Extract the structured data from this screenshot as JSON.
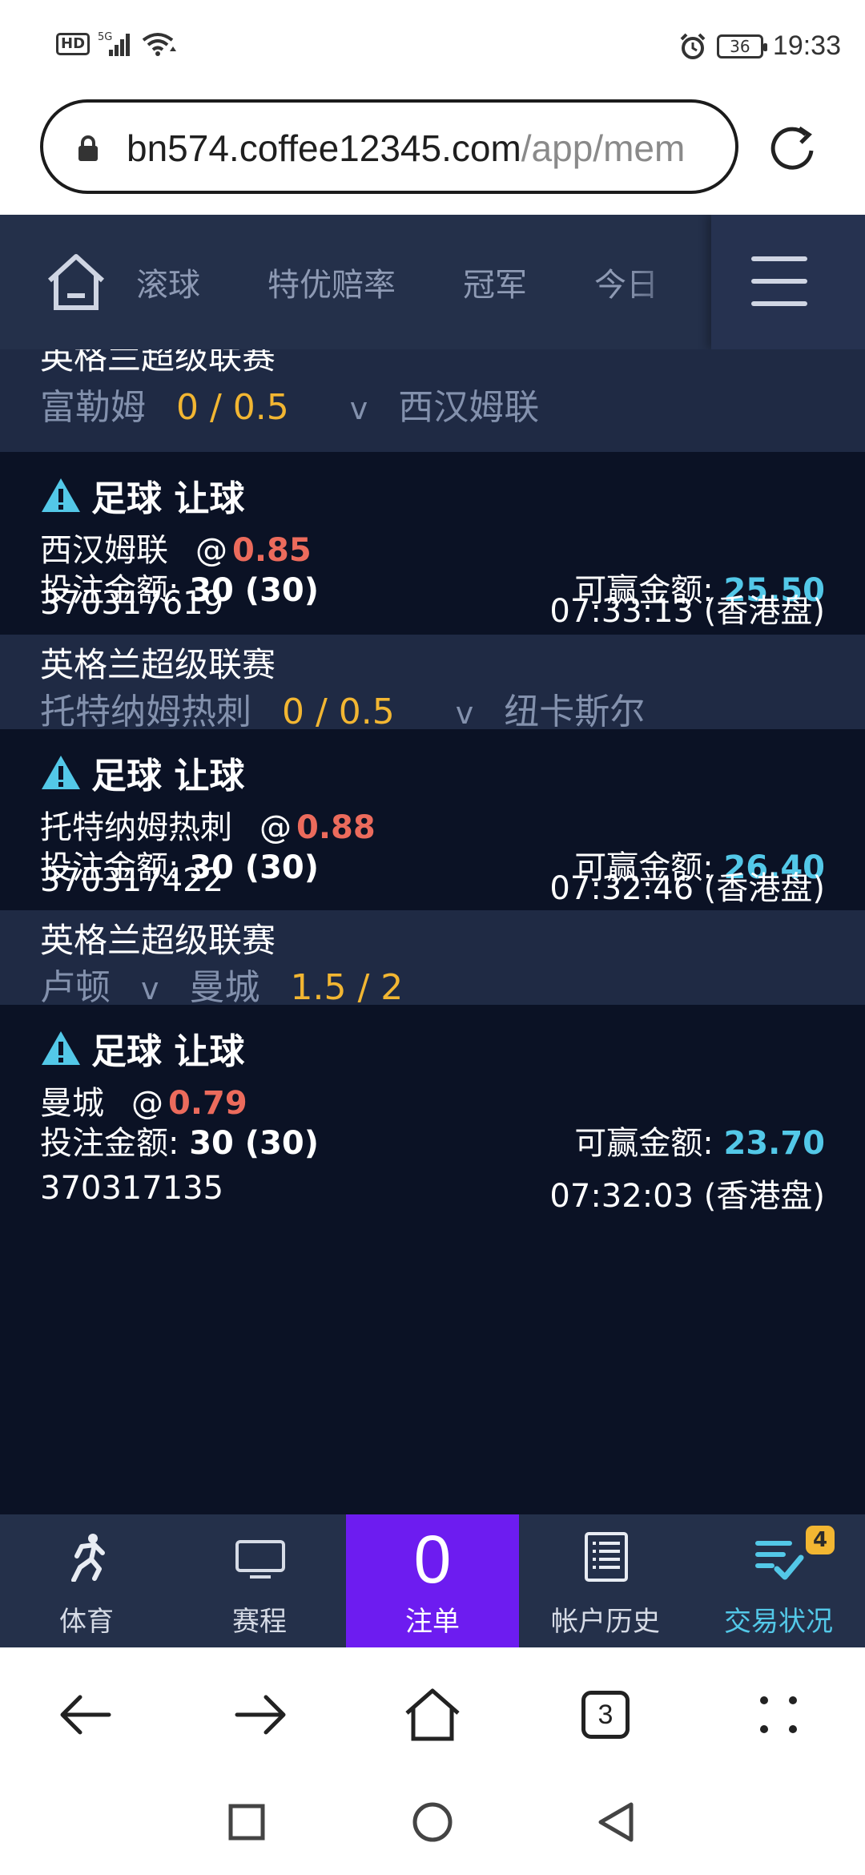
{
  "status_bar": {
    "network": "5G",
    "battery": "36",
    "time": "19:33",
    "icons": [
      "hd-icon",
      "signal-icon",
      "wifi-icon",
      "alarm-icon",
      "battery-icon"
    ]
  },
  "browser": {
    "url_host": "bn574.coffee12345.com",
    "url_path": "/app/mem",
    "tabs_count": "3"
  },
  "site_nav": {
    "tabs": [
      "滚球",
      "特优赔率",
      "冠军",
      "今日"
    ]
  },
  "partial_top": {
    "league": "英格兰超级联赛",
    "home": "富勒姆",
    "handicap": "0 / 0.5",
    "vs": "v",
    "away": "西汉姆联"
  },
  "bets": [
    {
      "bet_type": "足球 让球",
      "pick": "西汉姆联",
      "at": "@",
      "odds": "0.85",
      "stake_label": "投注金额:",
      "stake": "30 (30)",
      "win_label": "可赢金额:",
      "win": "25.50",
      "ticket_id": "370317619",
      "time": "07:33:13 (香港盘)"
    },
    {
      "league": "英格兰超级联赛",
      "home": "托特纳姆热刺",
      "handicap": "0 / 0.5",
      "vs": "v",
      "away": "纽卡斯尔",
      "bet_type": "足球 让球",
      "pick": "托特纳姆热刺",
      "at": "@",
      "odds": "0.88",
      "stake_label": "投注金额:",
      "stake": "30 (30)",
      "win_label": "可赢金额:",
      "win": "26.40",
      "ticket_id": "370317422",
      "time": "07:32:46 (香港盘)"
    },
    {
      "league": "英格兰超级联赛",
      "home": "卢顿",
      "vs": "v",
      "away": "曼城",
      "handicap": "1.5 / 2",
      "bet_type": "足球 让球",
      "pick": "曼城",
      "at": "@",
      "odds": "0.79",
      "stake_label": "投注金额:",
      "stake": "30 (30)",
      "win_label": "可赢金额:",
      "win": "23.70",
      "ticket_id": "370317135",
      "time": "07:32:03 (香港盘)"
    }
  ],
  "site_tabbar": {
    "sports": "体育",
    "schedule": "赛程",
    "betslip_count": "0",
    "betslip": "注单",
    "history": "帐户历史",
    "status": "交易状况",
    "status_badge": "4"
  },
  "colors": {
    "nav_bg": "#24304a",
    "league_bg": "#1f2a44",
    "card_bg": "#0b1225",
    "handicap": "#f2b632",
    "odds": "#ec6b5c",
    "win": "#53c8e8",
    "betslip_bg": "#6d1cf0"
  }
}
